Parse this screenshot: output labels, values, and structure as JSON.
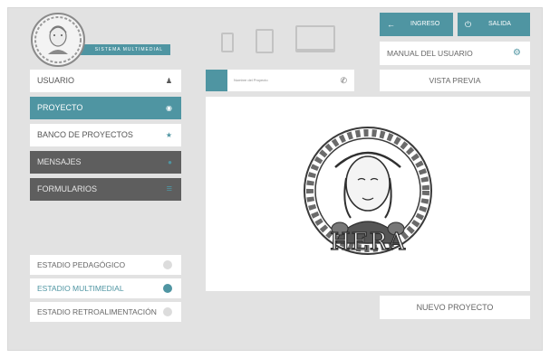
{
  "logo": {
    "subtitle": "SISTEMA MULTIMEDIAL",
    "name": "HERA"
  },
  "devices": [
    "phone-icon",
    "tablet-icon",
    "laptop-icon"
  ],
  "sidebar": {
    "items": [
      {
        "label": "USUARIO",
        "icon": "user-icon",
        "glyph": "♟"
      },
      {
        "label": "PROYECTO",
        "icon": "target-icon",
        "glyph": "◉"
      },
      {
        "label": "BANCO DE PROYECTOS",
        "icon": "star-icon",
        "glyph": "★"
      },
      {
        "label": "MENSAJES",
        "icon": "message-icon",
        "glyph": "●"
      },
      {
        "label": "FORMULARIOS",
        "icon": "list-icon",
        "glyph": "≡"
      }
    ]
  },
  "stages": {
    "items": [
      {
        "label": "ESTADIO PEDAGÓGICO",
        "active": false
      },
      {
        "label": "ESTADIO MULTIMEDIAL",
        "active": true
      },
      {
        "label": "ESTADIO RETROALIMENTACIÓN",
        "active": false
      }
    ]
  },
  "project": {
    "name_placeholder": "Nombre del Proyecto",
    "phone_glyph": "✆"
  },
  "topbar": {
    "ingreso_label": "INGRESO",
    "ingreso_glyph": "←",
    "salida_label": "SALIDA",
    "salida_glyph": "⏻",
    "manual_label": "MANUAL DEL USUARIO",
    "manual_glyph": "⚙",
    "preview_label": "VISTA PREVIA"
  },
  "canvas": {
    "logo_text": "HERA"
  },
  "new_project_label": "NUEVO PROYECTO",
  "colors": {
    "accent": "#4f95a2",
    "dark": "#5e5e5e",
    "background": "#e2e2e2"
  }
}
